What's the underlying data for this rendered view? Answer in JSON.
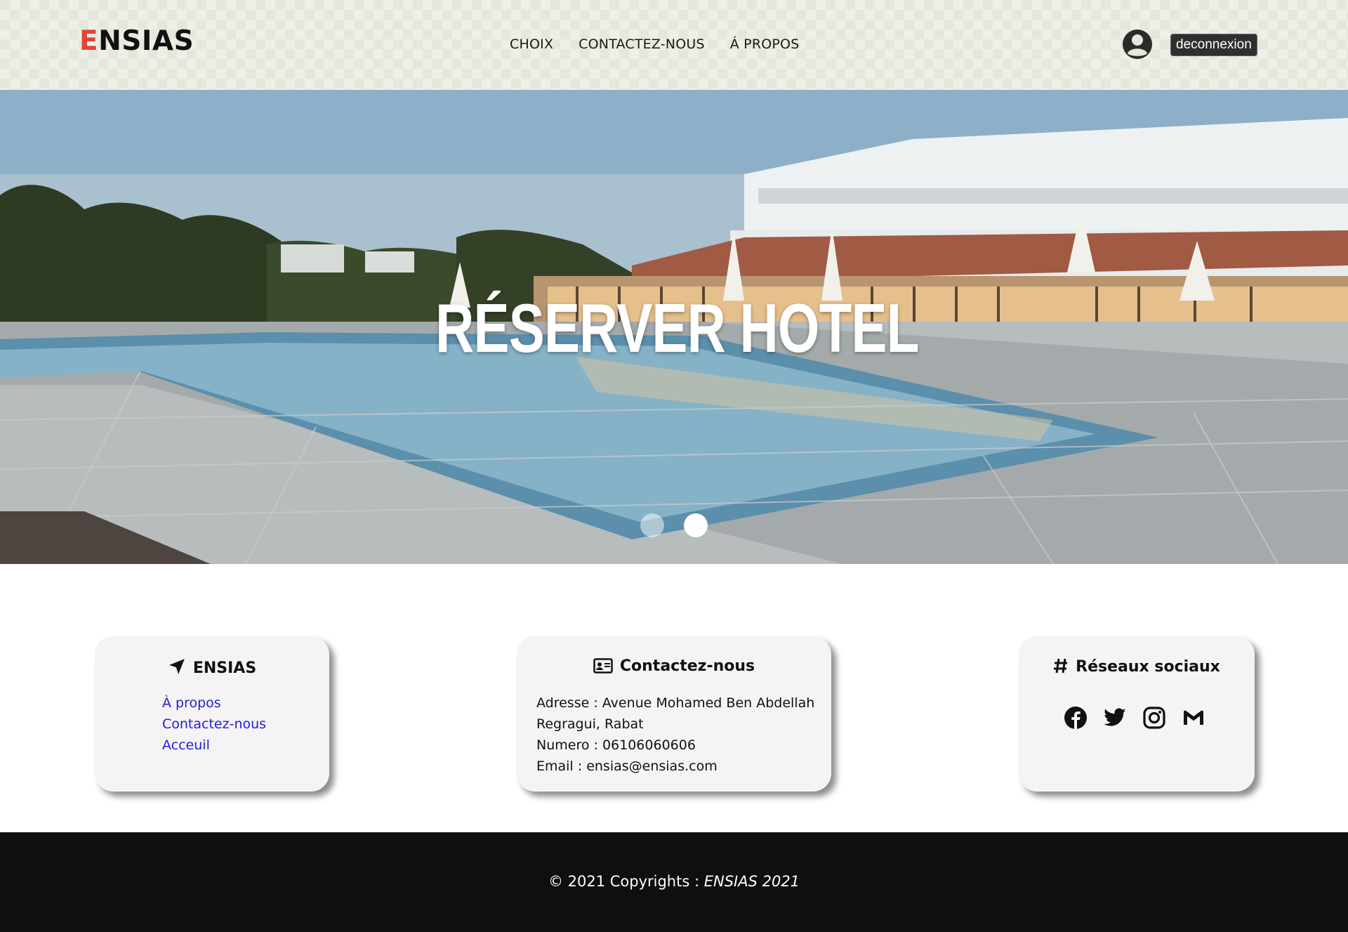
{
  "header": {
    "logo_first_letter": "E",
    "logo_rest": "NSIAS",
    "nav": [
      "CHOIX",
      "CONTACTEZ-NOUS",
      "Á PROPOS"
    ],
    "logout_label": "deconnexion"
  },
  "hero": {
    "title": "RÉSERVER HOTEL",
    "carousel": {
      "slides": 2,
      "active": 2
    }
  },
  "cards": {
    "ensias": {
      "title": "ENSIAS",
      "links": [
        "À propos",
        "Contactez-nous",
        "Acceuil"
      ]
    },
    "contact": {
      "title": "Contactez-nous",
      "address_line1": "Adresse : Avenue Mohamed Ben Abdellah",
      "address_line2": "Regragui, Rabat",
      "phone": "Numero : 06106060606",
      "email": "Email : ensias@ensias.com"
    },
    "social": {
      "title": "Réseaux sociaux",
      "icons": [
        "facebook-icon",
        "twitter-icon",
        "instagram-icon",
        "gmail-icon"
      ]
    }
  },
  "footer": {
    "copyright_prefix": "© 2021 Copyrights : ",
    "copyright_brand": "ENSIAS 2021"
  },
  "colors": {
    "header_bg": "#e4e8da",
    "logo_accent": "#e0453a",
    "link": "#2320d4",
    "card_bg": "#f5f3f4",
    "footer_bg": "#0f0f0f"
  }
}
